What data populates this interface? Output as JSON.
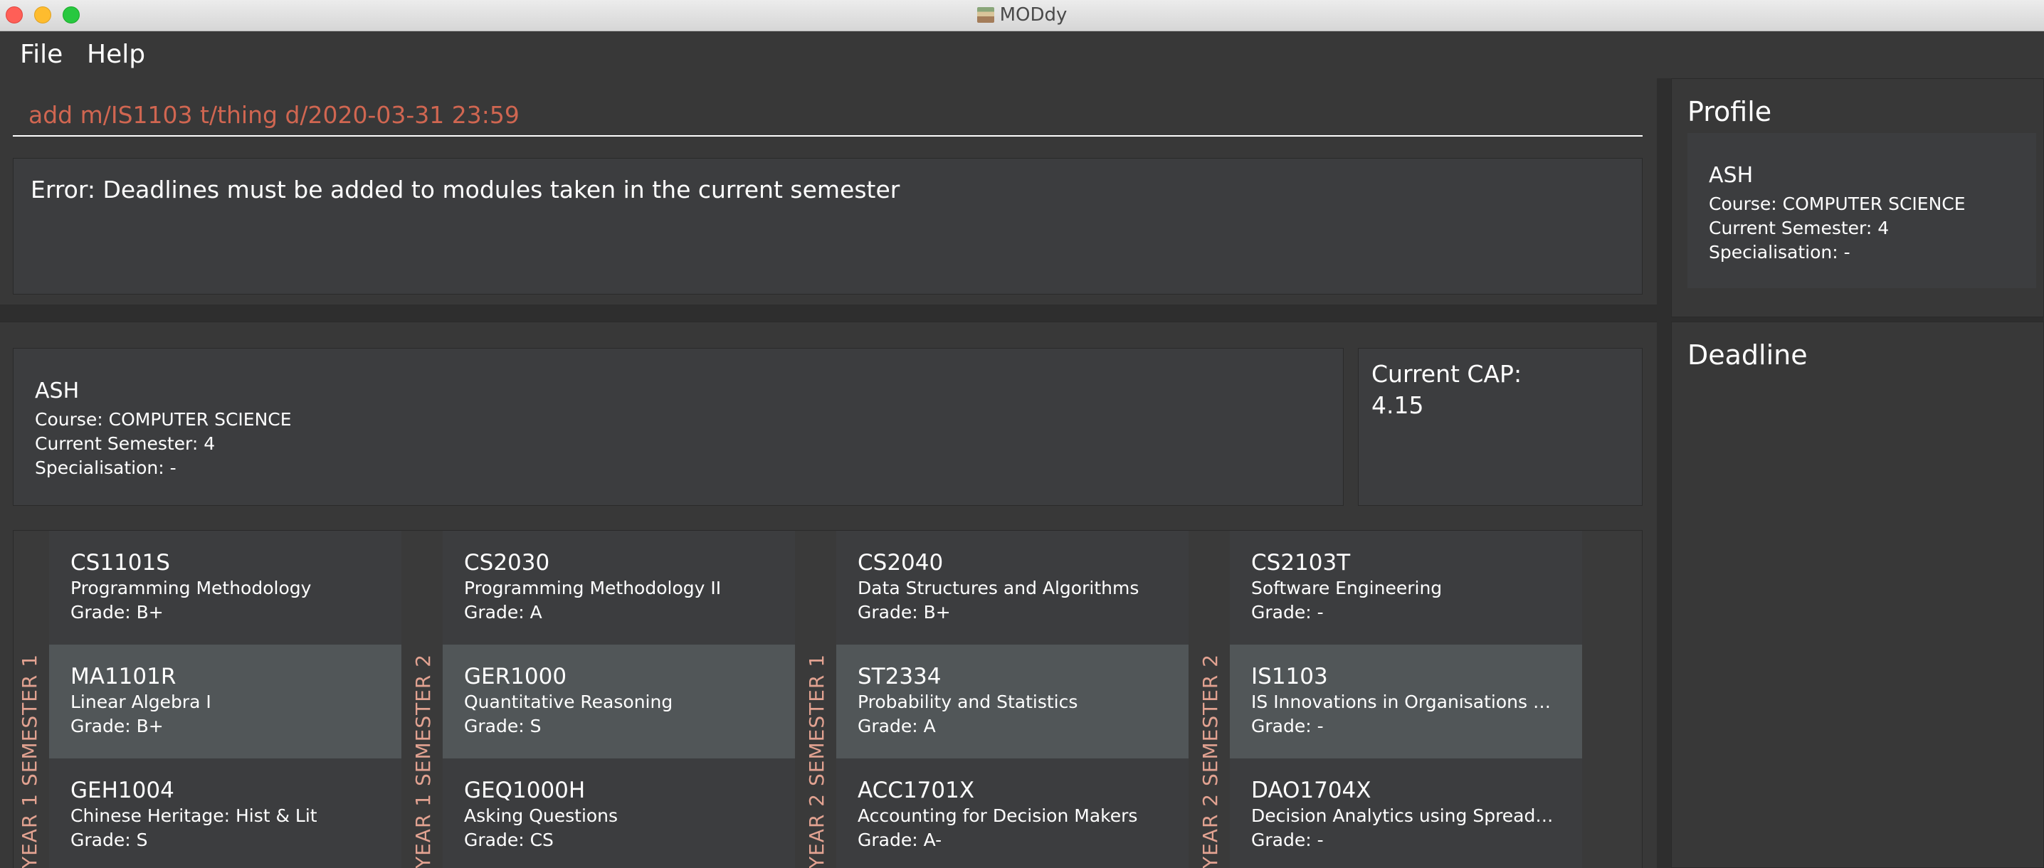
{
  "window": {
    "title": "MODdy"
  },
  "menu": {
    "file": "File",
    "help": "Help"
  },
  "command": {
    "value": "add m/IS1103 t/thing d/2020-03-31 23:59"
  },
  "result": {
    "message": "Error: Deadlines must be added to modules taken in the current semester"
  },
  "profile": {
    "name": "ASH",
    "course": "Course: COMPUTER SCIENCE",
    "semester": "Current Semester: 4",
    "specialisation": "Specialisation: -"
  },
  "cap": {
    "label": "Current CAP:",
    "value": "4.15"
  },
  "semesters": [
    {
      "label": "YEAR 1 SEMESTER 1",
      "modules": [
        {
          "code": "CS1101S",
          "title": "Programming Methodology",
          "grade": "Grade: B+"
        },
        {
          "code": "MA1101R",
          "title": "Linear Algebra I",
          "grade": "Grade: B+"
        },
        {
          "code": "GEH1004",
          "title": "Chinese Heritage: Hist & Lit",
          "grade": "Grade: S"
        }
      ]
    },
    {
      "label": "YEAR 1 SEMESTER 2",
      "modules": [
        {
          "code": "CS2030",
          "title": "Programming Methodology II",
          "grade": "Grade: A"
        },
        {
          "code": "GER1000",
          "title": "Quantitative Reasoning",
          "grade": "Grade: S"
        },
        {
          "code": "GEQ1000H",
          "title": "Asking Questions",
          "grade": "Grade: CS"
        }
      ]
    },
    {
      "label": "YEAR 2 SEMESTER 1",
      "modules": [
        {
          "code": "CS2040",
          "title": "Data Structures and Algorithms",
          "grade": "Grade: B+"
        },
        {
          "code": "ST2334",
          "title": "Probability and Statistics",
          "grade": "Grade: A"
        },
        {
          "code": "ACC1701X",
          "title": "Accounting for Decision Makers",
          "grade": "Grade: A-"
        }
      ]
    },
    {
      "label": "YEAR 2 SEMESTER 2",
      "modules": [
        {
          "code": "CS2103T",
          "title": "Software Engineering",
          "grade": "Grade: -"
        },
        {
          "code": "IS1103",
          "title": "IS Innovations in Organisations and Soc...",
          "grade": "Grade: -"
        },
        {
          "code": "DAO1704X",
          "title": "Decision Analytics using Spreadsheets",
          "grade": "Grade: -"
        }
      ]
    }
  ],
  "side": {
    "profile_title": "Profile",
    "deadline_title": "Deadline"
  }
}
